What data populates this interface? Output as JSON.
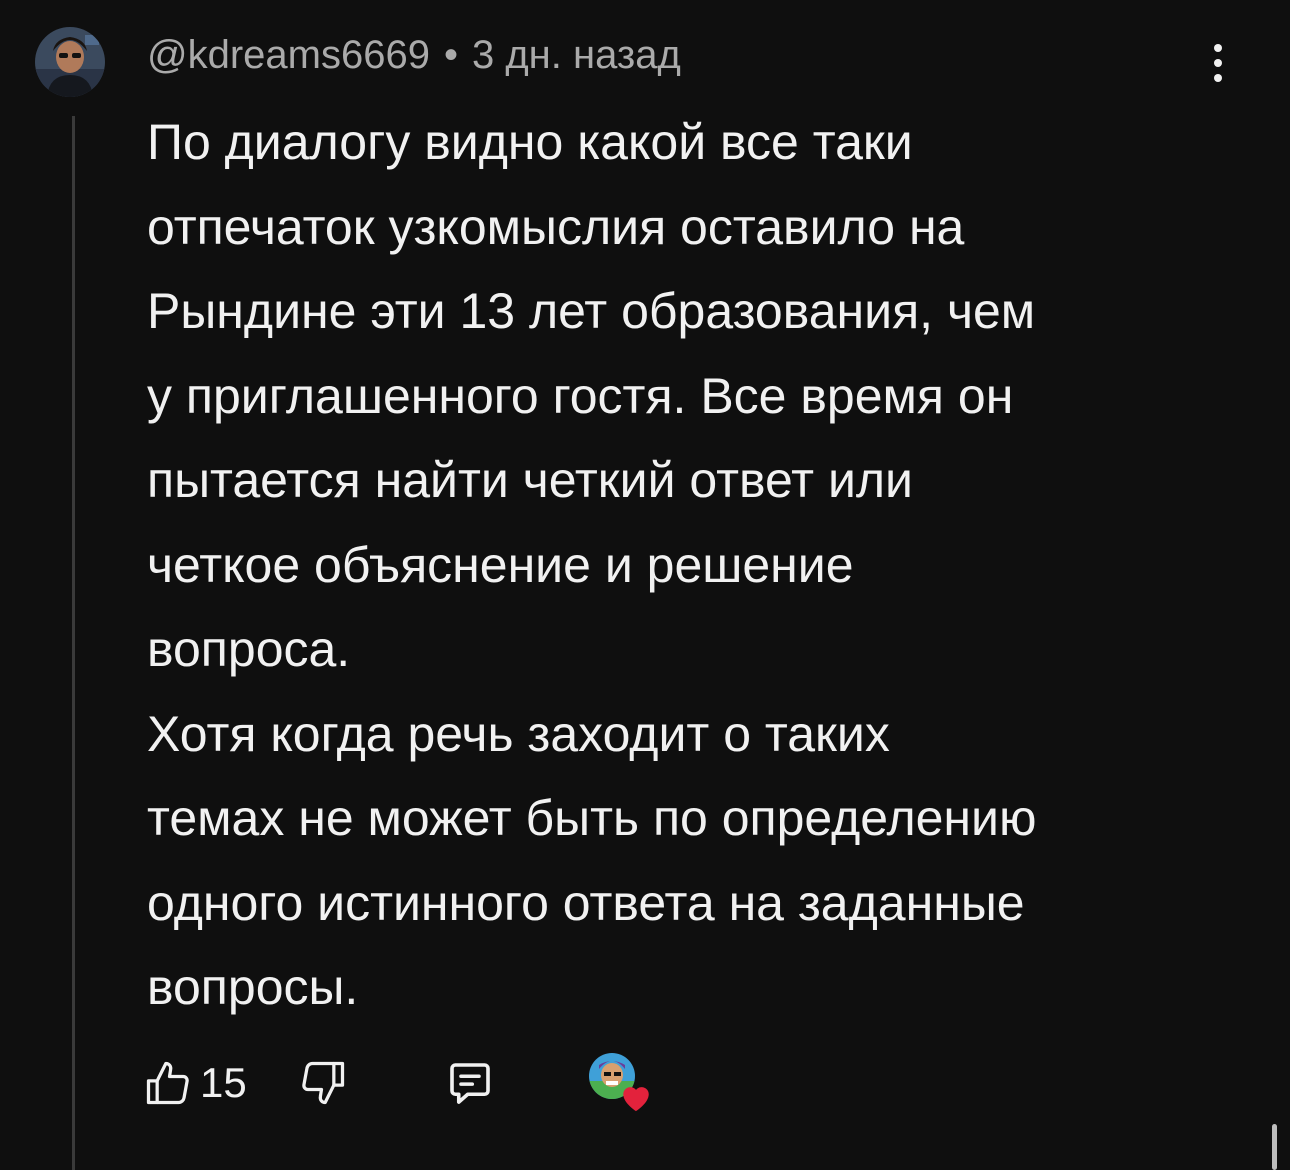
{
  "comment": {
    "author": "@kdreams6669",
    "separator": "•",
    "timestamp": "3 дн. назад",
    "text_lines": [
      "По диалогу видно какой все таки",
      "отпечаток узкомыслия оставило на",
      "Рындине эти 13 лет образования, чем",
      "у приглашенного гостя. Все время он",
      "пытается найти четкий ответ или",
      "четкое объяснение и решение",
      "вопроса.",
      "Хотя когда речь заходит о таких",
      "темах не может быть по определению",
      "одного истинного ответа на заданные",
      "вопросы."
    ],
    "like_count": "15"
  },
  "icons": {
    "menu": "more-vert-icon",
    "like": "thumb-up-icon",
    "dislike": "thumb-down-icon",
    "reply": "reply-icon",
    "creator_heart": "heart-icon"
  },
  "colors": {
    "background": "#0f0f0f",
    "text": "#f1f1f1",
    "secondary_text": "#aaaaaa",
    "heart": "#e3223c"
  }
}
